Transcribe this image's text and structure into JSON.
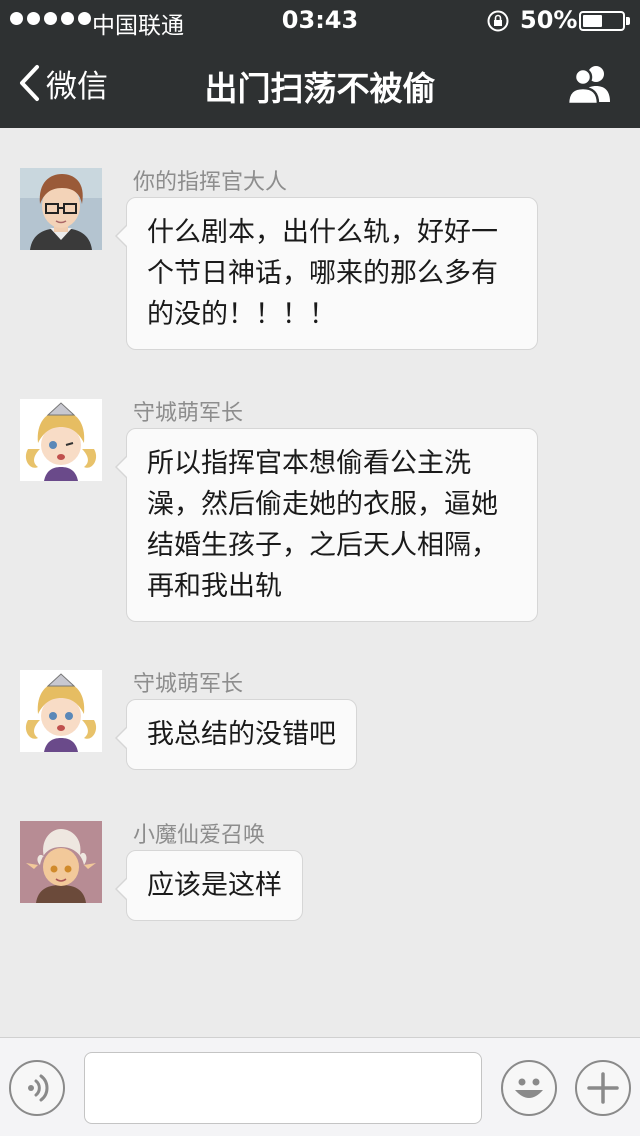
{
  "status_bar": {
    "carrier": "中国联通",
    "time": "03:43",
    "battery_percent": "50%",
    "battery_level": 0.5
  },
  "nav": {
    "back_label": "微信",
    "title": "出门扫荡不被偷"
  },
  "messages": [
    {
      "sender": "你的指挥官大人",
      "text": "什么剧本，出什么轨，好好一个节日神话，哪来的那么多有的没的！！！！",
      "avatar": "commander-avatar"
    },
    {
      "sender": "守城萌军长",
      "text": "所以指挥官本想偷看公主洗澡，然后偷走她的衣服，逼她结婚生孩子，之后天人相隔，再和我出轨",
      "avatar": "blonde-girl-avatar"
    },
    {
      "sender": "守城萌军长",
      "text": "我总结的没错吧",
      "avatar": "blonde-girl-avatar"
    },
    {
      "sender": "小魔仙爱召唤",
      "text": "应该是这样",
      "avatar": "fairy-boy-avatar"
    }
  ],
  "input_bar": {
    "voice_icon": "voice-icon",
    "emoji_icon": "emoji-icon",
    "plus_icon": "plus-icon",
    "text_value": ""
  }
}
